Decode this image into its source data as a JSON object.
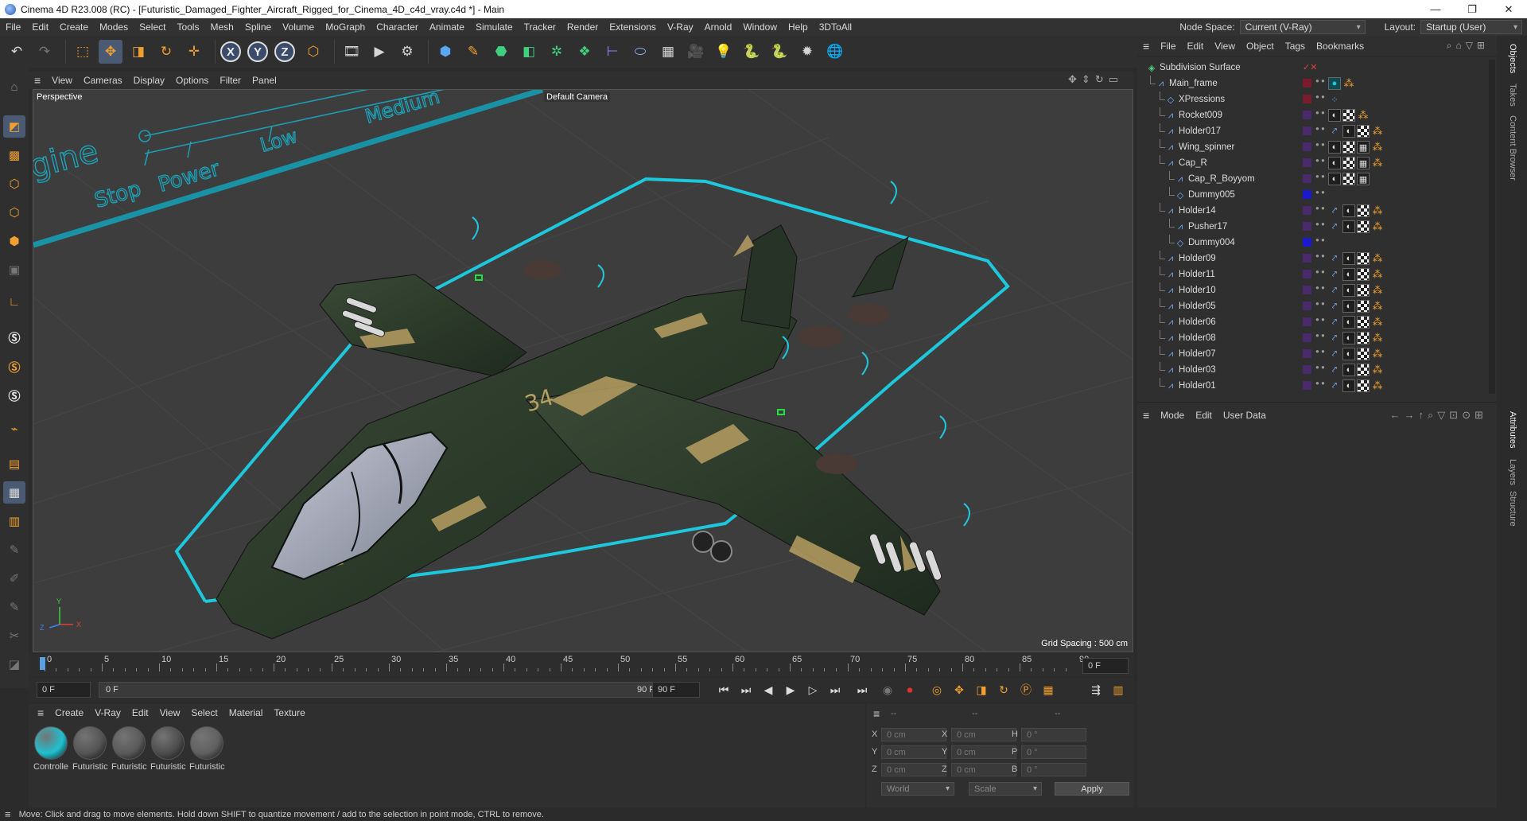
{
  "window": {
    "title": "Cinema 4D R23.008 (RC) - [Futuristic_Damaged_Fighter_Aircraft_Rigged_for_Cinema_4D_c4d_vray.c4d *] - Main",
    "buttons": {
      "minimize": "—",
      "restore": "❐",
      "close": "✕"
    }
  },
  "menubar": {
    "items": [
      "File",
      "Edit",
      "Create",
      "Modes",
      "Select",
      "Tools",
      "Mesh",
      "Spline",
      "Volume",
      "MoGraph",
      "Character",
      "Animate",
      "Simulate",
      "Tracker",
      "Render",
      "Extensions",
      "V-Ray",
      "Arnold",
      "Window",
      "Help",
      "3DToAll"
    ],
    "node_space_label": "Node Space:",
    "node_space_value": "Current (V-Ray)",
    "layout_label": "Layout:",
    "layout_value": "Startup (User)"
  },
  "toolbar": {
    "axis_x": "X",
    "axis_y": "Y",
    "axis_z": "Z"
  },
  "viewport": {
    "menu": [
      "View",
      "Cameras",
      "Display",
      "Options",
      "Filter",
      "Panel"
    ],
    "view_name": "Perspective",
    "camera_label": "Default Camera",
    "grid_spacing": "Grid Spacing : 500 cm",
    "hud_text": {
      "engine": "gine",
      "stop": "Stop",
      "power": "Power",
      "low": "Low",
      "medium": "Medium"
    },
    "hull_number": "34",
    "axis_labels": {
      "y": "Y",
      "x": "X",
      "z": "Z"
    },
    "colors": {
      "bg": "#3d3d3d",
      "selection": "#1ec8dc",
      "hull": "#2c3a2a",
      "camo": "#b79e62",
      "canopy": "#9ea4b4"
    }
  },
  "timeline": {
    "ticks": [
      "0",
      "5",
      "10",
      "15",
      "20",
      "25",
      "30",
      "35",
      "40",
      "45",
      "50",
      "55",
      "60",
      "65",
      "70",
      "75",
      "80",
      "85",
      "90"
    ],
    "current_frame_field": "0 F"
  },
  "transport": {
    "start_field": "0 F",
    "range_start": "0 F",
    "range_end": "90 F",
    "end_field": "90 F"
  },
  "material_manager": {
    "menu": [
      "Create",
      "V-Ray",
      "Edit",
      "View",
      "Select",
      "Material",
      "Texture"
    ],
    "materials": [
      {
        "name": "Controlle",
        "color": "#20c0d0"
      },
      {
        "name": "Futuristic",
        "color": "#555555"
      },
      {
        "name": "Futuristic",
        "color": "#5a5a5a"
      },
      {
        "name": "Futuristic",
        "color": "#4d4d4d"
      },
      {
        "name": "Futuristic",
        "color": "#606060"
      }
    ]
  },
  "coordinates": {
    "header_dash1": "--",
    "header_dash2": "--",
    "header_dash3": "--",
    "rows": [
      {
        "a": "X",
        "av": "0 cm",
        "b": "X",
        "bv": "0 cm",
        "c": "H",
        "cv": "0 °"
      },
      {
        "a": "Y",
        "av": "0 cm",
        "b": "Y",
        "bv": "0 cm",
        "c": "P",
        "cv": "0 °"
      },
      {
        "a": "Z",
        "av": "0 cm",
        "b": "Z",
        "bv": "0 cm",
        "c": "B",
        "cv": "0 °"
      }
    ],
    "world": "World",
    "scale": "Scale",
    "apply": "Apply"
  },
  "status": "Move: Click and drag to move elements. Hold down SHIFT to quantize movement / add to the selection in point mode, CTRL to remove.",
  "object_manager": {
    "menu": [
      "File",
      "Edit",
      "View",
      "Object",
      "Tags",
      "Bookmarks"
    ],
    "objects": [
      {
        "name": "Subdivision Surface",
        "indent": 0,
        "icon": "subdiv",
        "layer": "",
        "tags": []
      },
      {
        "name": "Main_frame",
        "indent": 1,
        "icon": "joint",
        "layer": "#7a1c2c",
        "tags": [
          "sphere-tag",
          "orange"
        ]
      },
      {
        "name": "XPressions",
        "indent": 2,
        "icon": "null",
        "layer": "#7a1c2c",
        "tags": [
          "xpresso"
        ]
      },
      {
        "name": "Rocket009",
        "indent": 2,
        "icon": "joint",
        "layer": "#4a2a6a",
        "tags": [
          "mat",
          "chk",
          "orange"
        ]
      },
      {
        "name": "Holder017",
        "indent": 2,
        "icon": "joint",
        "layer": "#4a2a6a",
        "tags": [
          "ik",
          "mat",
          "chk",
          "orange"
        ]
      },
      {
        "name": "Wing_spinner",
        "indent": 2,
        "icon": "joint",
        "layer": "#4a2a6a",
        "tags": [
          "mat",
          "chk",
          "grid",
          "orange"
        ]
      },
      {
        "name": "Cap_R",
        "indent": 2,
        "icon": "joint",
        "layer": "#4a2a6a",
        "tags": [
          "mat",
          "chk",
          "grid",
          "orange"
        ]
      },
      {
        "name": "Cap_R_Boyyom",
        "indent": 3,
        "icon": "joint",
        "layer": "#4a2a6a",
        "tags": [
          "mat",
          "chk",
          "grid"
        ]
      },
      {
        "name": "Dummy005",
        "indent": 3,
        "icon": "null",
        "layer": "#1a1acc",
        "tags": []
      },
      {
        "name": "Holder14",
        "indent": 2,
        "icon": "joint",
        "layer": "#4a2a6a",
        "tags": [
          "ik",
          "mat",
          "chk",
          "orange"
        ]
      },
      {
        "name": "Pusher17",
        "indent": 3,
        "icon": "joint",
        "layer": "#4a2a6a",
        "tags": [
          "ik",
          "mat",
          "chk",
          "orange"
        ]
      },
      {
        "name": "Dummy004",
        "indent": 3,
        "icon": "null",
        "layer": "#1a1acc",
        "tags": []
      },
      {
        "name": "Holder09",
        "indent": 2,
        "icon": "joint",
        "layer": "#4a2a6a",
        "tags": [
          "ik",
          "mat",
          "chk",
          "orange"
        ]
      },
      {
        "name": "Holder11",
        "indent": 2,
        "icon": "joint",
        "layer": "#4a2a6a",
        "tags": [
          "ik",
          "mat",
          "chk",
          "orange"
        ]
      },
      {
        "name": "Holder10",
        "indent": 2,
        "icon": "joint",
        "layer": "#4a2a6a",
        "tags": [
          "ik",
          "mat",
          "chk",
          "orange"
        ]
      },
      {
        "name": "Holder05",
        "indent": 2,
        "icon": "joint",
        "layer": "#4a2a6a",
        "tags": [
          "ik",
          "mat",
          "chk",
          "orange"
        ]
      },
      {
        "name": "Holder06",
        "indent": 2,
        "icon": "joint",
        "layer": "#4a2a6a",
        "tags": [
          "ik",
          "mat",
          "chk",
          "orange"
        ]
      },
      {
        "name": "Holder08",
        "indent": 2,
        "icon": "joint",
        "layer": "#4a2a6a",
        "tags": [
          "ik",
          "mat",
          "chk",
          "orange"
        ]
      },
      {
        "name": "Holder07",
        "indent": 2,
        "icon": "joint",
        "layer": "#4a2a6a",
        "tags": [
          "ik",
          "mat",
          "chk",
          "orange"
        ]
      },
      {
        "name": "Holder03",
        "indent": 2,
        "icon": "joint",
        "layer": "#4a2a6a",
        "tags": [
          "ik",
          "mat",
          "chk",
          "orange"
        ]
      },
      {
        "name": "Holder01",
        "indent": 2,
        "icon": "joint",
        "layer": "#4a2a6a",
        "tags": [
          "ik",
          "mat",
          "chk",
          "orange"
        ]
      }
    ]
  },
  "attribute_manager": {
    "menu": [
      "Mode",
      "Edit",
      "User Data"
    ]
  },
  "right_tabs": {
    "objects": "Objects",
    "takes": "Takes",
    "content_browser": "Content Browser",
    "attributes": "Attributes",
    "layers": "Layers",
    "structure": "Structure"
  }
}
